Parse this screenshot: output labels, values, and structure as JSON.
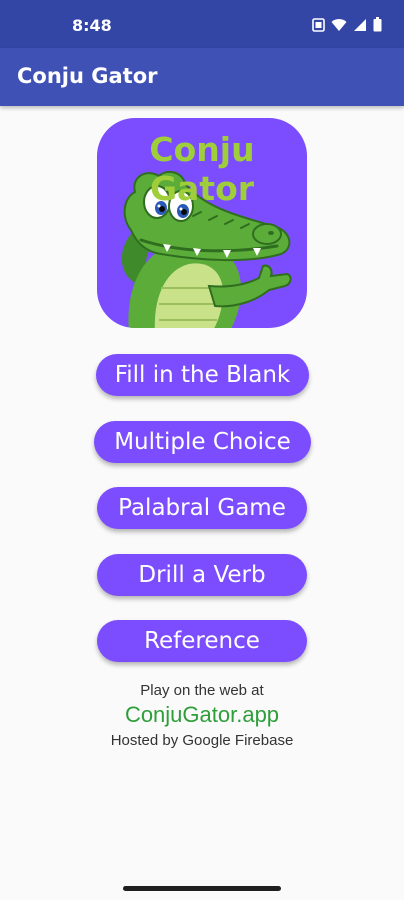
{
  "status_bar": {
    "time": "8:48",
    "icons": [
      "sim-card-icon",
      "wifi-icon",
      "signal-icon",
      "battery-icon"
    ]
  },
  "app_bar": {
    "title": "Conju Gator"
  },
  "logo": {
    "text": "Conju Gator",
    "icon": "alligator-mascot-icon"
  },
  "menu": {
    "buttons": [
      "Fill in the Blank",
      "Multiple Choice",
      "Palabral Game",
      "Drill a Verb",
      "Reference"
    ]
  },
  "footer": {
    "line1": "Play on the web at",
    "link": "ConjuGator.app",
    "line3": "Hosted by Google Firebase"
  },
  "colors": {
    "status_bar": "#3346a6",
    "app_bar": "#3f51b5",
    "accent": "#7c4dff",
    "logo_text": "#9fce3a",
    "link": "#2e9e3a",
    "background": "#fafafa"
  }
}
